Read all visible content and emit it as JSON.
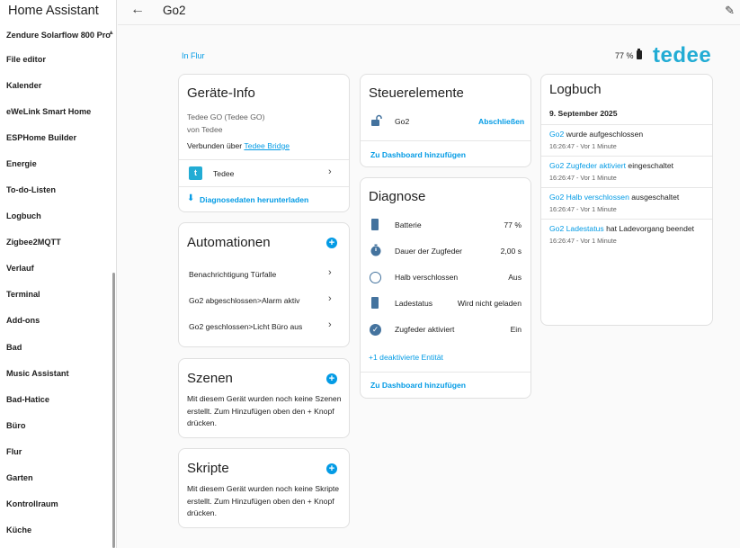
{
  "app": {
    "title": "Home Assistant"
  },
  "sidebar": {
    "items": [
      "Zendure Solarflow 800 Pro",
      "File editor",
      "Kalender",
      "eWeLink Smart Home",
      "ESPHome Builder",
      "Energie",
      "To-do-Listen",
      "Logbuch",
      "Zigbee2MQTT",
      "Verlauf",
      "Terminal",
      "Add-ons",
      "Bad",
      "Music Assistant",
      "Bad-Hatice",
      "Büro",
      "Flur",
      "Garten",
      "Kontrollraum",
      "Küche"
    ]
  },
  "header": {
    "title": "Go2"
  },
  "device": {
    "area": "In Flur",
    "battery": "77 %",
    "brand": "tedee"
  },
  "info": {
    "title": "Geräte-Info",
    "model": "Tedee GO (Tedee GO)",
    "manufacturer": "von Tedee",
    "connected_prefix": "Verbunden über",
    "connected_link": "Tedee Bridge",
    "integration": "Tedee",
    "download": "Diagnosedaten herunterladen"
  },
  "automations": {
    "title": "Automationen",
    "items": [
      "Benachrichtigung Türfalle",
      "Go2 abgeschlossen>Alarm aktiv",
      "Go2 geschlossen>Licht Büro aus"
    ]
  },
  "scenes": {
    "title": "Szenen",
    "text": "Mit diesem Gerät wurden noch keine Szenen erstellt. Zum Hinzufügen oben den + Knopf drücken."
  },
  "scripts": {
    "title": "Skripte",
    "text": "Mit diesem Gerät wurden noch keine Skripte erstellt. Zum Hinzufügen oben den + Knopf drücken."
  },
  "controls": {
    "title": "Steuerelemente",
    "entity": "Go2",
    "action": "Abschließen",
    "add_dashboard": "Zu Dashboard hinzufügen"
  },
  "diagnostics": {
    "title": "Diagnose",
    "rows": [
      {
        "label": "Batterie",
        "value": "77 %",
        "icon": "battery-icon"
      },
      {
        "label": "Dauer der Zugfeder",
        "value": "2,00 s",
        "icon": "timer-icon"
      },
      {
        "label": "Halb verschlossen",
        "value": "Aus",
        "icon": "circle-outline-icon"
      },
      {
        "label": "Ladestatus",
        "value": "Wird nicht geladen",
        "icon": "battery-icon"
      },
      {
        "label": "Zugfeder aktiviert",
        "value": "Ein",
        "icon": "check-circle-icon"
      }
    ],
    "disabled": "+1 deaktivierte Entität",
    "add_dashboard": "Zu Dashboard hinzufügen"
  },
  "logbook": {
    "title": "Logbuch",
    "date": "9. September 2025",
    "entries": [
      {
        "entity": "Go2",
        "text": "wurde aufgeschlossen",
        "time": "16:26:47 - Vor 1 Minute"
      },
      {
        "entity": "Go2 Zugfeder aktiviert",
        "text": "eingeschaltet",
        "time": "16:26:47 - Vor 1 Minute"
      },
      {
        "entity": "Go2 Halb verschlossen",
        "text": "ausgeschaltet",
        "time": "16:26:47 - Vor 1 Minute"
      },
      {
        "entity": "Go2 Ladestatus",
        "text": "hat Ladevorgang beendet",
        "time": "16:26:47 - Vor 1 Minute"
      }
    ]
  },
  "colors": {
    "accent": "#039be5",
    "brand": "#22acd4"
  }
}
